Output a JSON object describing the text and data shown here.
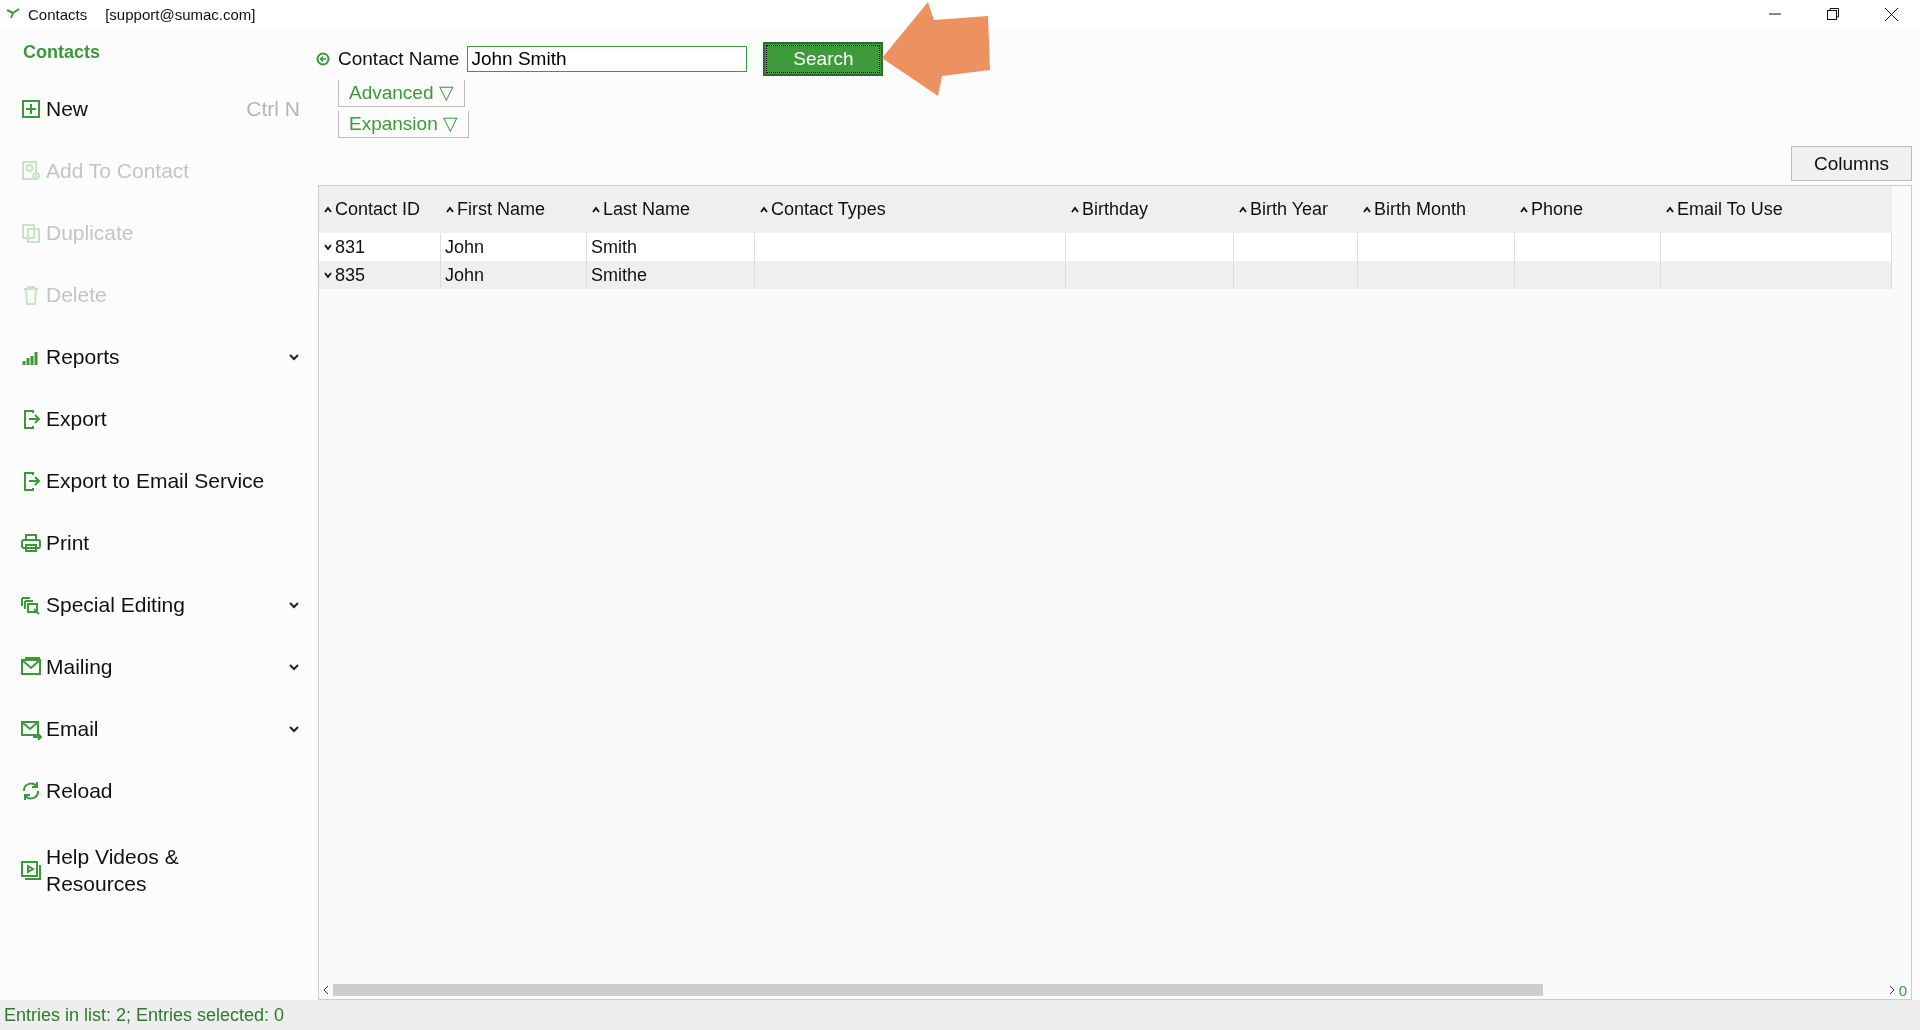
{
  "window": {
    "title": "Contacts",
    "account": "[support@sumac.com]"
  },
  "sidebar": {
    "title": "Contacts",
    "items": [
      {
        "label": "New",
        "shortcut": "Ctrl N",
        "disabled": false,
        "has_menu": false
      },
      {
        "label": "Add To Contact",
        "disabled": true,
        "has_menu": false
      },
      {
        "label": "Duplicate",
        "disabled": true,
        "has_menu": false
      },
      {
        "label": "Delete",
        "disabled": true,
        "has_menu": false
      },
      {
        "label": "Reports",
        "disabled": false,
        "has_menu": true
      },
      {
        "label": "Export",
        "disabled": false,
        "has_menu": false
      },
      {
        "label": "Export to Email Service",
        "disabled": false,
        "has_menu": false
      },
      {
        "label": "Print",
        "disabled": false,
        "has_menu": false
      },
      {
        "label": "Special Editing",
        "disabled": false,
        "has_menu": true
      },
      {
        "label": "Mailing",
        "disabled": false,
        "has_menu": true
      },
      {
        "label": "Email",
        "disabled": false,
        "has_menu": true
      },
      {
        "label": "Reload",
        "disabled": false,
        "has_menu": false
      },
      {
        "label": "Help Videos & Resources",
        "disabled": false,
        "has_menu": false
      }
    ]
  },
  "search": {
    "label": "Contact Name",
    "value": "John Smith",
    "button": "Search"
  },
  "toggles": [
    {
      "label": "Advanced",
      "symbol": "▽"
    },
    {
      "label": "Expansion",
      "symbol": "▽"
    }
  ],
  "columns_button": "Columns",
  "table": {
    "columns": [
      "Contact ID",
      "First Name",
      "Last Name",
      "Contact Types",
      "Birthday",
      "Birth Year",
      "Birth Month",
      "Phone",
      "Email To Use"
    ],
    "rows": [
      {
        "cells": [
          "831",
          "John",
          "Smith",
          "",
          "",
          "",
          "",
          "",
          ""
        ]
      },
      {
        "cells": [
          "835",
          "John",
          "Smithe",
          "",
          "",
          "",
          "",
          "",
          ""
        ]
      }
    ]
  },
  "scroll_counter": "0",
  "status_bar": "Entries in list: 2; Entries selected: 0"
}
